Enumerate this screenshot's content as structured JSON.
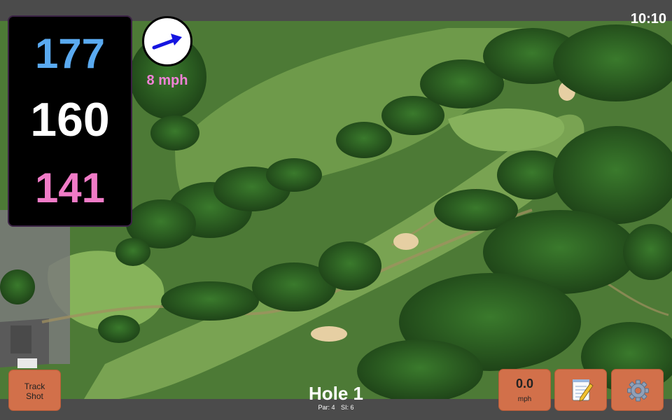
{
  "status": {
    "clock": "10:10"
  },
  "distances": {
    "back": "177",
    "middle": "160",
    "front": "141"
  },
  "wind": {
    "speed_label": "8 mph",
    "direction_icon": "wind-arrow-icon"
  },
  "buttons": {
    "track_shot_line1": "Track",
    "track_shot_line2": "Shot",
    "speed_value": "0.0",
    "speed_unit": "mph",
    "notes_icon": "notepad-icon",
    "settings_icon": "gear-icon"
  },
  "hole": {
    "title": "Hole 1",
    "par": "Par: 4",
    "si": "SI: 6"
  },
  "colors": {
    "back_distance": "#5aaaf0",
    "middle_distance": "#ffffff",
    "front_distance": "#f07bc7",
    "wind_speed": "#f082d6",
    "button": "#d2704a",
    "bar": "#4b4b4b"
  }
}
